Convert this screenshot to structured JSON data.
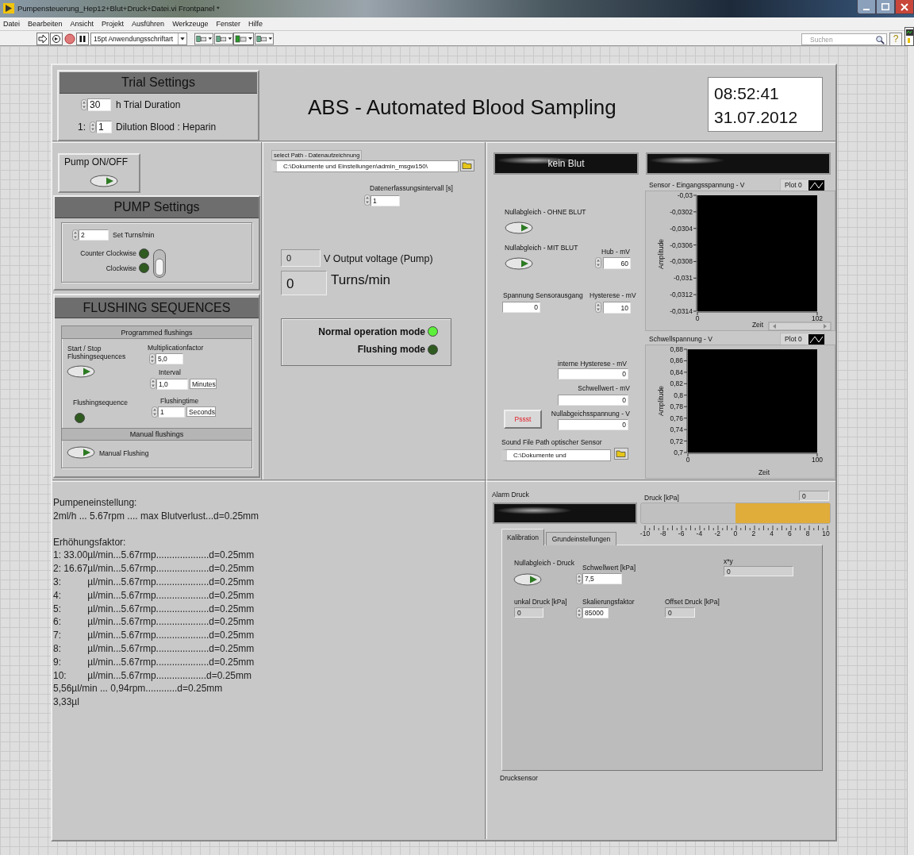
{
  "window": {
    "title": "Pumpensteuerung_Hep12+Blut+Druck+Datei.vi Frontpanel *"
  },
  "menu": [
    "Datei",
    "Bearbeiten",
    "Ansicht",
    "Projekt",
    "Ausführen",
    "Werkzeuge",
    "Fenster",
    "Hilfe"
  ],
  "toolbar": {
    "font": "15pt Anwendungsschriftart",
    "search_placeholder": "Suchen",
    "help": "?"
  },
  "trial_settings": {
    "title": "Trial Settings",
    "duration": {
      "value": "30",
      "label": "h Trial Duration"
    },
    "dilution": {
      "prefix": "1:",
      "value": "1",
      "label": "Dilution Blood : Heparin"
    }
  },
  "app_title": "ABS - Automated Blood Sampling",
  "clock": {
    "time": "08:52:41",
    "date": "31.07.2012"
  },
  "pump_switch": {
    "label": "Pump ON/OFF",
    "on": false
  },
  "pump_settings": {
    "title": "PUMP Settings",
    "turns": {
      "value": "2",
      "label": "Set Turns/min"
    },
    "leds": [
      {
        "label": "Counter Clockwise",
        "on": false
      },
      {
        "label": "Clockwise",
        "on": false
      }
    ],
    "direction_switch": {
      "on": false
    }
  },
  "flushing": {
    "title": "FLUSHING SEQUENCES",
    "programmed": {
      "title": "Programmed flushings",
      "start_stop": {
        "label": "Start / Stop Flushingsequences",
        "on": false
      },
      "multiplication": {
        "label": "Multiplicationfactor",
        "value": "5,0"
      },
      "interval": {
        "label": "Interval",
        "value": "1,0",
        "unit": "Minutes"
      },
      "indicator": {
        "label": "Flushingsequence",
        "on": false
      },
      "flushingtime": {
        "label": "Flushingtime",
        "value": "1",
        "unit": "Seconds"
      }
    },
    "manual": {
      "title": "Manual flushings",
      "button": {
        "label": "Manual Flushing",
        "on": false
      }
    }
  },
  "data_logging": {
    "path_label": "select Path - Datenaufzeichnung",
    "path": "C:\\Dokumente und Einstellungen\\admin_msgw150\\",
    "interval": {
      "label": "Datenerfassungsintervall [s]",
      "value": "1"
    }
  },
  "output": {
    "voltage": {
      "value": "0",
      "label": "V Output voltage (Pump)"
    },
    "turns": {
      "value": "0",
      "label": "Turns/min"
    }
  },
  "modes": [
    {
      "label": "Normal operation mode",
      "on": true
    },
    {
      "label": "Flushing mode",
      "on": false
    }
  ],
  "blood_sensor": {
    "status": "kein Blut",
    "zero_without": {
      "label": "Nullabgleich - OHNE BLUT",
      "on": false
    },
    "zero_with": {
      "label": "Nullabgleich - MIT BLUT",
      "on": false
    },
    "hub": {
      "label": "Hub - mV",
      "value": "60"
    },
    "sensor_voltage": {
      "label": "Spannung Sensorausgang",
      "value": "0"
    },
    "hysteresis": {
      "label": "Hysterese - mV",
      "value": "10"
    },
    "internal_hysteresis": {
      "label": "interne Hysterese - mV",
      "value": "0"
    },
    "threshold": {
      "label": "Schwellwert - mV",
      "value": "0"
    },
    "zero_voltage": {
      "label": "Nullabgeichsspannung - V",
      "value": "0"
    },
    "pssst_button": "Pssst",
    "sound_path": {
      "label": "Sound File Path optischer Sensor",
      "value": "C:\\Dokumente und"
    }
  },
  "charts": [
    {
      "legend": "Plot 0",
      "chart_data": {
        "type": "line",
        "title": "Sensor - Eingangsspannung - V",
        "xlabel": "Zeit",
        "ylabel": "Amplitude",
        "xlim": [
          0,
          102
        ],
        "ylim": [
          -0.0314,
          -0.03
        ],
        "xticks": [
          0,
          102
        ],
        "yticks": [
          {
            "value": -0.03,
            "label": "-0,03"
          },
          {
            "value": -0.0302,
            "label": "-0,0302"
          },
          {
            "value": -0.0304,
            "label": "-0,0304"
          },
          {
            "value": -0.0306,
            "label": "-0,0306"
          },
          {
            "value": -0.0308,
            "label": "-0,0308"
          },
          {
            "value": -0.031,
            "label": "-0,031"
          },
          {
            "value": -0.0312,
            "label": "-0,0312"
          },
          {
            "value": -0.0314,
            "label": "-0,0314"
          }
        ]
      }
    },
    {
      "legend": "Plot 0",
      "chart_data": {
        "type": "line",
        "title": "Schwellspannung - V",
        "xlabel": "Zeit",
        "ylabel": "Amplitude",
        "xlim": [
          0,
          100
        ],
        "ylim": [
          0.7,
          0.88
        ],
        "xticks": [
          0,
          100
        ],
        "yticks": [
          {
            "value": 0.88,
            "label": "0,88"
          },
          {
            "value": 0.86,
            "label": "0,86"
          },
          {
            "value": 0.84,
            "label": "0,84"
          },
          {
            "value": 0.82,
            "label": "0,82"
          },
          {
            "value": 0.8,
            "label": "0,8"
          },
          {
            "value": 0.78,
            "label": "0,78"
          },
          {
            "value": 0.76,
            "label": "0,76"
          },
          {
            "value": 0.74,
            "label": "0,74"
          },
          {
            "value": 0.72,
            "label": "0,72"
          },
          {
            "value": 0.7,
            "label": "0,7"
          }
        ]
      }
    }
  ],
  "pressure": {
    "alarm_label": "Alarm Druck",
    "gauge": {
      "label": "Druck [kPa]",
      "value": "0",
      "level": 0.5,
      "scale": [
        "-10",
        "-8",
        "-6",
        "-4",
        "-2",
        "0",
        "2",
        "4",
        "6",
        "8",
        "10"
      ]
    },
    "tabs": [
      {
        "label": "Kalibration",
        "selected": true
      },
      {
        "label": "Grundeinstellungen",
        "selected": false
      }
    ],
    "zero": {
      "label": "Nullabgleich - Druck",
      "on": false
    },
    "threshold": {
      "label": "Schwellwert [kPa]",
      "value": "7,5"
    },
    "product": {
      "label": "x*y",
      "value": "0"
    },
    "raw": {
      "label": "unkal Druck [kPa]",
      "value": "0"
    },
    "scale_factor": {
      "label": "Skalierungsfaktor",
      "value": "85000"
    },
    "offset": {
      "label": "Offset Druck [kPa]",
      "value": "0"
    },
    "caption": "Drucksensor"
  },
  "notes": [
    [
      "Pumpeneinstellung:",
      "2ml/h ... 5.67rpm .... max Blutverlust...d=0.25mm"
    ],
    [
      "Erhöhungsfaktor:",
      "1: 33.00µl/min...5.67rmp....................d=0.25mm",
      "2: 16.67µl/min...5.67rmp....................d=0.25mm",
      "3:          µl/min...5.67rmp....................d=0.25mm",
      "4:          µl/min...5.67rmp....................d=0.25mm",
      "5:          µl/min...5.67rmp....................d=0.25mm",
      "6:          µl/min...5.67rmp....................d=0.25mm",
      "7:          µl/min...5.67rmp....................d=0.25mm",
      "8:          µl/min...5.67rmp....................d=0.25mm",
      "9:          µl/min...5.67rmp....................d=0.25mm",
      "10:        µl/min...5.67rmp...................d=0.25mm",
      "5,56µl/min ... 0,94rpm............d=0.25mm",
      "3,33µl"
    ]
  ]
}
